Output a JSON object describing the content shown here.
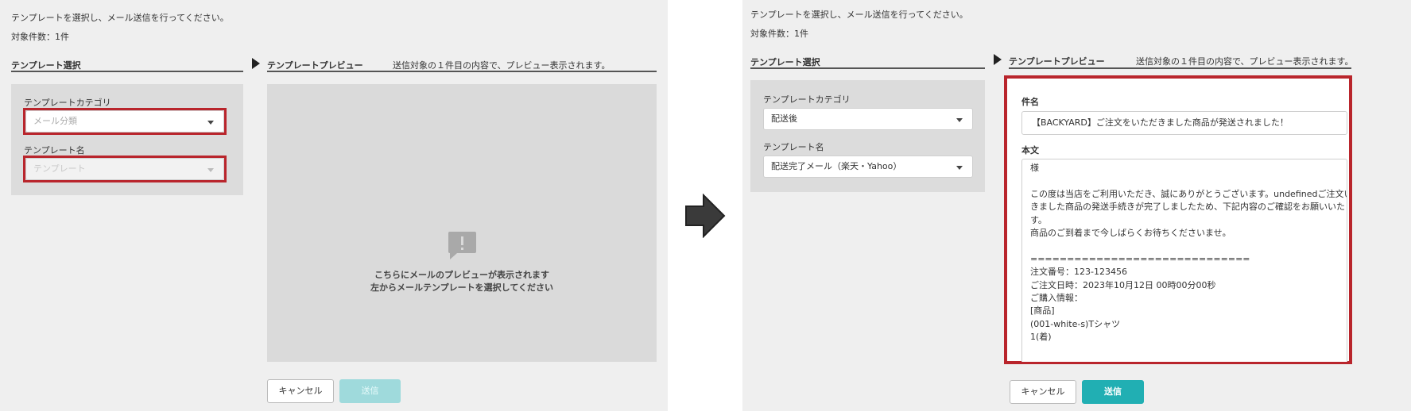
{
  "left": {
    "instruction": "テンプレートを選択し、メール送信を行ってください。",
    "target_count": "対象件数：1件",
    "section_select": "テンプレート選択",
    "category_label": "テンプレートカテゴリ",
    "category_placeholder": "メール分類",
    "name_label": "テンプレート名",
    "name_placeholder": "テンプレート",
    "preview_title": "テンプレートプレビュー",
    "preview_note": "送信対象の１件目の内容で、プレビュー表示されます。",
    "empty_line1": "こちらにメールのプレビューが表示されます",
    "empty_line2": "左からメールテンプレートを選択してください",
    "cancel_label": "キャンセル",
    "send_label": "送信"
  },
  "right": {
    "instruction": "テンプレートを選択し、メール送信を行ってください。",
    "target_count": "対象件数：1件",
    "section_select": "テンプレート選択",
    "category_label": "テンプレートカテゴリ",
    "category_value": "配送後",
    "name_label": "テンプレート名",
    "name_value": "配送完了メール（楽天・Yahoo）",
    "preview_title": "テンプレートプレビュー",
    "preview_note": "送信対象の１件目の内容で、プレビュー表示されます。",
    "subject_label": "件名",
    "subject_value": "【BACKYARD】ご注文をいただきました商品が発送されました！",
    "body_label": "本文",
    "body_lines": [
      "様",
      "",
      "この度は当店をご利用いただき、誠にありがとうございます。undefinedご注文いただ",
      "きました商品の発送手続きが完了しましたため、下記内容のご確認をお願いいたしま",
      "す。",
      "商品のご到着まで今しばらくお待ちくださいませ。",
      "",
      "==============================",
      "注文番号：123-123456",
      "ご注文日時：2023年10月12日 00時00分00秒",
      "ご購入情報：",
      "[商品]",
      "(001-white-s)Tシャツ",
      "1(着)"
    ],
    "cancel_label": "キャンセル",
    "send_label": "送信"
  },
  "colors": {
    "highlight": "#b9252c",
    "send_enabled": "#21afb3",
    "send_disabled": "#9fdadc",
    "panel_bg": "#efefef"
  },
  "icons": {
    "empty_state": "alert-message-icon",
    "transition": "right-arrow-icon",
    "section_marker": "triangle-right-icon"
  }
}
